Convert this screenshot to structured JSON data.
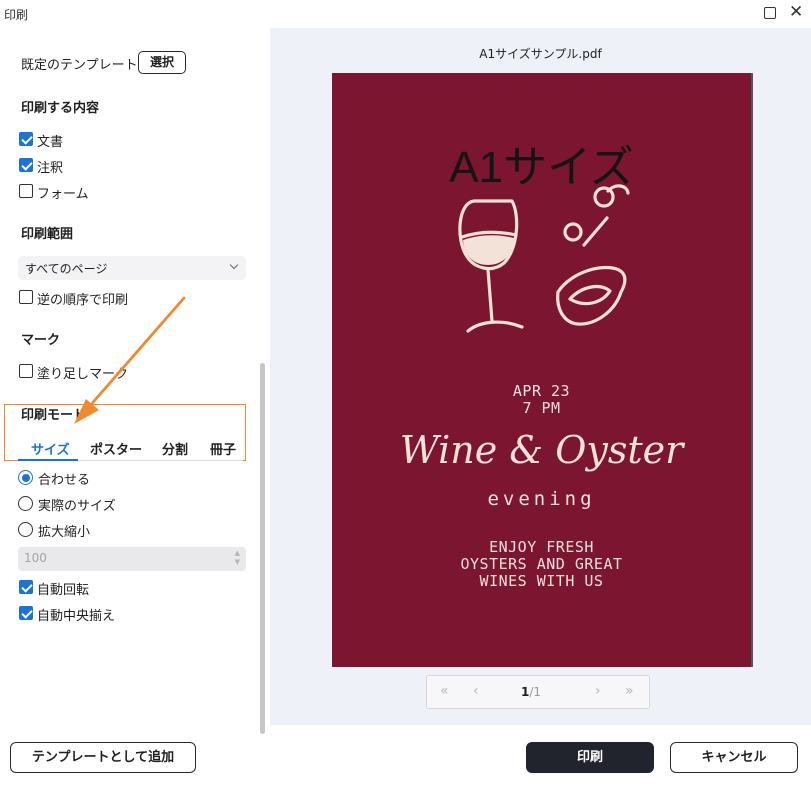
{
  "window": {
    "title": "印刷",
    "maximize_icon": "maximize-icon",
    "close_glyph": "✕"
  },
  "left": {
    "template_label": "既定のテンプレート",
    "template_button": "選択",
    "content_heading": "印刷する内容",
    "content_items": [
      {
        "label": "文書",
        "checked": true
      },
      {
        "label": "注釈",
        "checked": true
      },
      {
        "label": "フォーム",
        "checked": false
      }
    ],
    "range_heading": "印刷範囲",
    "range_value": "すべてのページ",
    "reverse_label": "逆の順序で印刷",
    "reverse_checked": false,
    "mark_heading": "マーク",
    "bleed_label": "塗り足しマーク",
    "bleed_checked": false,
    "mode_heading": "印刷モード",
    "mode_tabs": [
      "サイズ",
      "ポスター",
      "分割",
      "冊子"
    ],
    "active_tab": "サイズ",
    "size_options": [
      {
        "label": "合わせる",
        "selected": true
      },
      {
        "label": "実際のサイズ",
        "selected": false
      },
      {
        "label": "拡大縮小",
        "selected": false
      }
    ],
    "zoom_value": "100",
    "auto_rotate_label": "自動回転",
    "auto_rotate_checked": true,
    "auto_center_label": "自動中央揃え",
    "auto_center_checked": true
  },
  "preview": {
    "filename": "A1サイズサンプル.pdf",
    "page_title": "A1サイズ",
    "date_line1": "APR 23",
    "date_line2": "7 PM",
    "event_title": "Wine & Oyster",
    "event_subtitle": "evening",
    "promo_line1": "ENJOY FRESH",
    "promo_line2": "OYSTERS AND GREAT",
    "promo_line3": "WINES WITH US",
    "page_background": "#7c1630",
    "pager": {
      "current": "1",
      "total": "/1"
    }
  },
  "footer": {
    "add_template": "テンプレートとして追加",
    "print": "印刷",
    "cancel": "キャンセル"
  },
  "colors": {
    "accent": "#1a73d9",
    "annotation": "#f08a30",
    "print_button": "#21242c"
  }
}
